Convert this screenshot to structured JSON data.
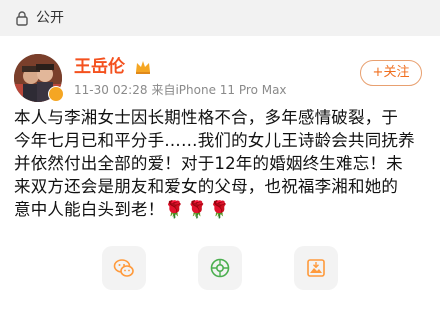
{
  "visibility": {
    "label": "公开",
    "icon": "lock-icon"
  },
  "post": {
    "author": {
      "name": "王岳伦",
      "avatar_icon": "avatar-icon",
      "verified_icon": "verified-badge-icon",
      "vip_icon": "crown-icon"
    },
    "meta": {
      "date": "11-30",
      "time": "02:28",
      "source": "来自iPhone 11 Pro Max"
    },
    "follow_label": "+关注",
    "lines": [
      "本人与李湘女士因长期性格不合，多年感情破裂，于",
      "今年七月已和平分手……我们的女儿王诗龄会共同抚养",
      "并依然付出全部的爱！对于12年的婚姻终生难忘！未",
      "来双方还会是朋友和爱女的父母，也祝福李湘和她的",
      "意中人能白头到老！"
    ],
    "roses": "🌹🌹🌹"
  },
  "share_actions": [
    {
      "icon": "wechat-icon"
    },
    {
      "icon": "moments-icon"
    },
    {
      "icon": "save-image-icon"
    }
  ],
  "colors": {
    "author_name": "#f4511e",
    "follow_accent": "#f06f1f",
    "meta_text": "#8a8a8a",
    "topbar_bg": "#f2f2f2",
    "action_icon": "#ff9a3c"
  }
}
